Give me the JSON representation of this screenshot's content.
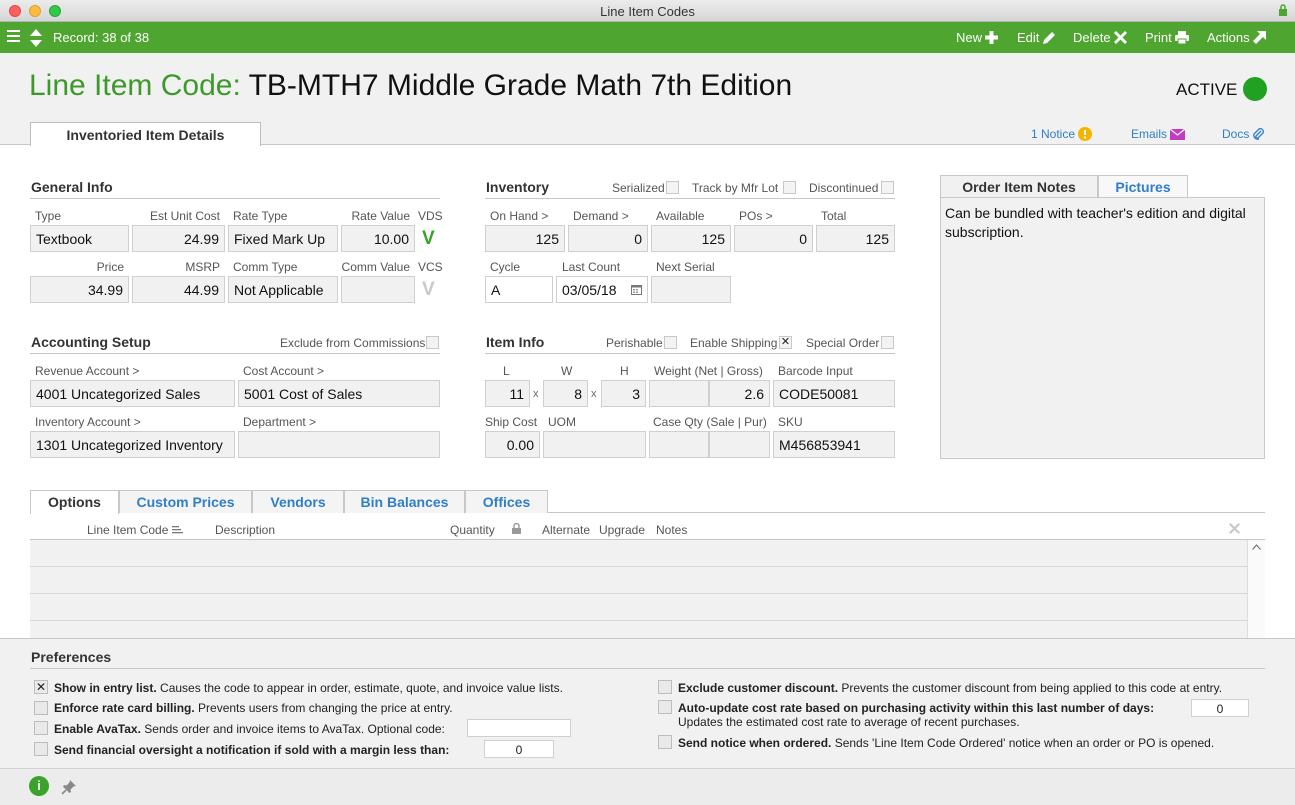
{
  "window": {
    "title": "Line Item Codes"
  },
  "toolbar": {
    "record": "Record: 38 of 38",
    "new": "New",
    "edit": "Edit",
    "delete": "Delete",
    "print": "Print",
    "actions": "Actions"
  },
  "header": {
    "label": "Line Item Code:",
    "value": "TB-MTH7 Middle Grade Math 7th Edition",
    "status": "ACTIVE",
    "status_color": "#21a121",
    "tab": "Inventoried Item Details",
    "notice": "1 Notice",
    "emails": "Emails",
    "docs": "Docs"
  },
  "general": {
    "title": "General Info",
    "type_label": "Type",
    "type": "Textbook",
    "est_unit_cost_label": "Est Unit Cost",
    "est_unit_cost": "24.99",
    "rate_type_label": "Rate Type",
    "rate_type": "Fixed Mark Up",
    "rate_value_label": "Rate Value",
    "rate_value": "10.00",
    "vds_label": "VDS",
    "vds_mark": "V",
    "price_label": "Price",
    "price": "34.99",
    "msrp_label": "MSRP",
    "msrp": "44.99",
    "comm_type_label": "Comm Type",
    "comm_type": "Not Applicable",
    "comm_value_label": "Comm Value",
    "comm_value": "",
    "vcs_label": "VCS",
    "vcs_mark": "V"
  },
  "inventory": {
    "title": "Inventory",
    "serialized": "Serialized",
    "track_lot": "Track by Mfr Lot",
    "discontinued": "Discontinued",
    "on_hand_label": "On Hand >",
    "on_hand": "125",
    "demand_label": "Demand >",
    "demand": "0",
    "available_label": "Available",
    "available": "125",
    "pos_label": "POs >",
    "pos": "0",
    "total_label": "Total",
    "total": "125",
    "cycle_label": "Cycle",
    "cycle": "A",
    "last_count_label": "Last Count",
    "last_count": "03/05/18",
    "next_serial_label": "Next Serial",
    "next_serial": ""
  },
  "accounting": {
    "title": "Accounting Setup",
    "exclude_commissions": "Exclude from Commissions",
    "revenue_label": "Revenue Account >",
    "revenue": "4001 Uncategorized Sales",
    "cost_label": "Cost Account >",
    "cost": "5001 Cost of Sales",
    "inventory_label": "Inventory Account >",
    "inventory": "1301 Uncategorized Inventory",
    "department_label": "Department >",
    "department": ""
  },
  "item_info": {
    "title": "Item Info",
    "perishable": "Perishable",
    "enable_shipping": "Enable Shipping",
    "enable_shipping_mark": "✕",
    "special_order": "Special Order",
    "l_label": "L",
    "l": "11",
    "w_label": "W",
    "w": "8",
    "h_label": "H",
    "h": "3",
    "x": "x",
    "weight_label": "Weight (Net | Gross)",
    "weight_net": "",
    "weight_gross": "2.6",
    "barcode_label": "Barcode Input",
    "barcode": "CODE50081",
    "ship_cost_label": "Ship Cost",
    "ship_cost": "0.00",
    "uom_label": "UOM",
    "uom": "",
    "case_qty_label": "Case Qty (Sale | Pur)",
    "case_sale": "",
    "case_pur": "",
    "sku_label": "SKU",
    "sku": "M456853941"
  },
  "notes": {
    "tab_notes": "Order Item Notes",
    "tab_pictures": "Pictures",
    "text": "Can be bundled with teacher's edition and digital subscription."
  },
  "options": {
    "tabs": [
      "Options",
      "Custom Prices",
      "Vendors",
      "Bin Balances",
      "Offices"
    ],
    "columns": {
      "code": "Line Item Code",
      "description": "Description",
      "quantity": "Quantity",
      "alternate": "Alternate",
      "upgrade": "Upgrade",
      "notes": "Notes"
    }
  },
  "preferences": {
    "title": "Preferences",
    "show_entry_bold": "Show in entry list.",
    "show_entry_desc": " Causes the code to appear in order, estimate, quote, and invoice value lists.",
    "show_entry_mark": "✕",
    "enforce_bold": "Enforce rate card billing.",
    "enforce_desc": " Prevents users from changing the price at entry.",
    "avatax_bold": "Enable AvaTax.",
    "avatax_desc": " Sends order and invoice items to AvaTax. Optional code:",
    "avatax_code": "",
    "oversight_bold": "Send financial oversight a notification if sold with a margin less than:",
    "oversight_value": "0",
    "exclude_bold": "Exclude customer discount.",
    "exclude_desc": " Prevents the customer discount from being applied to this code at entry.",
    "auto_bold": "Auto-update cost rate based on purchasing activity within this last number of days:",
    "auto_desc": "Updates the estimated cost rate to average of recent purchases.",
    "auto_value": "0",
    "notice_bold": "Send notice when ordered.",
    "notice_desc": " Sends 'Line Item Code Ordered' notice when an order or PO is opened."
  }
}
